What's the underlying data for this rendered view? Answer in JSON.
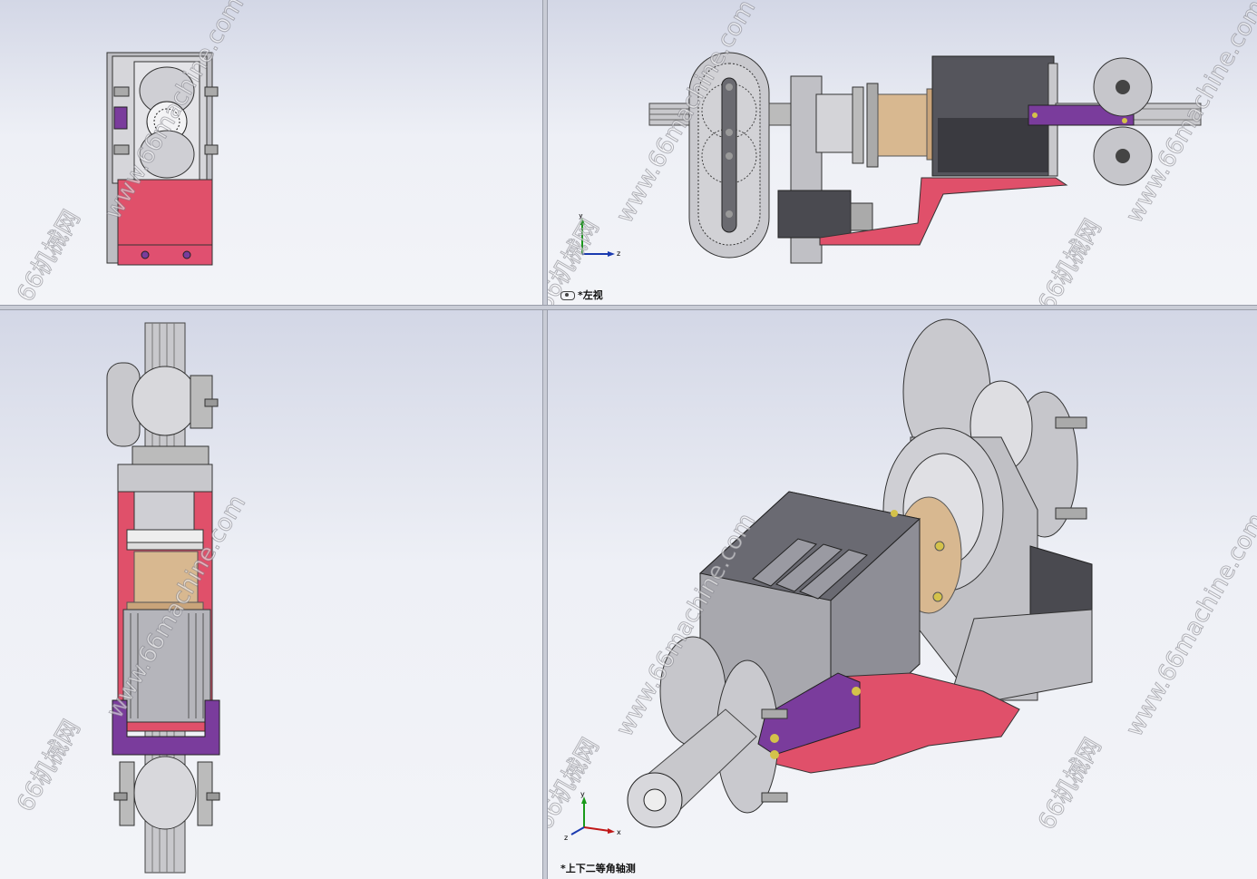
{
  "viewports": {
    "top_left": {
      "label": ""
    },
    "top_right": {
      "label": "*左视"
    },
    "bottom_left": {
      "label": ""
    },
    "bottom_right": {
      "label": "*上下二等角轴测"
    }
  },
  "watermarks": {
    "cn": "66机械网",
    "url": "www.66machine.com",
    "url_short": "66machine"
  },
  "axis": {
    "x": "x",
    "y": "y",
    "z": "z"
  },
  "colors": {
    "steel": "#c8c8cc",
    "dark_steel": "#4a4a50",
    "frame_pink": "#e0506a",
    "bracket_purple": "#7a3c9c",
    "bronze": "#d8b890",
    "background_top": "#d3d7e6",
    "background_bottom": "#f3f4f8"
  }
}
